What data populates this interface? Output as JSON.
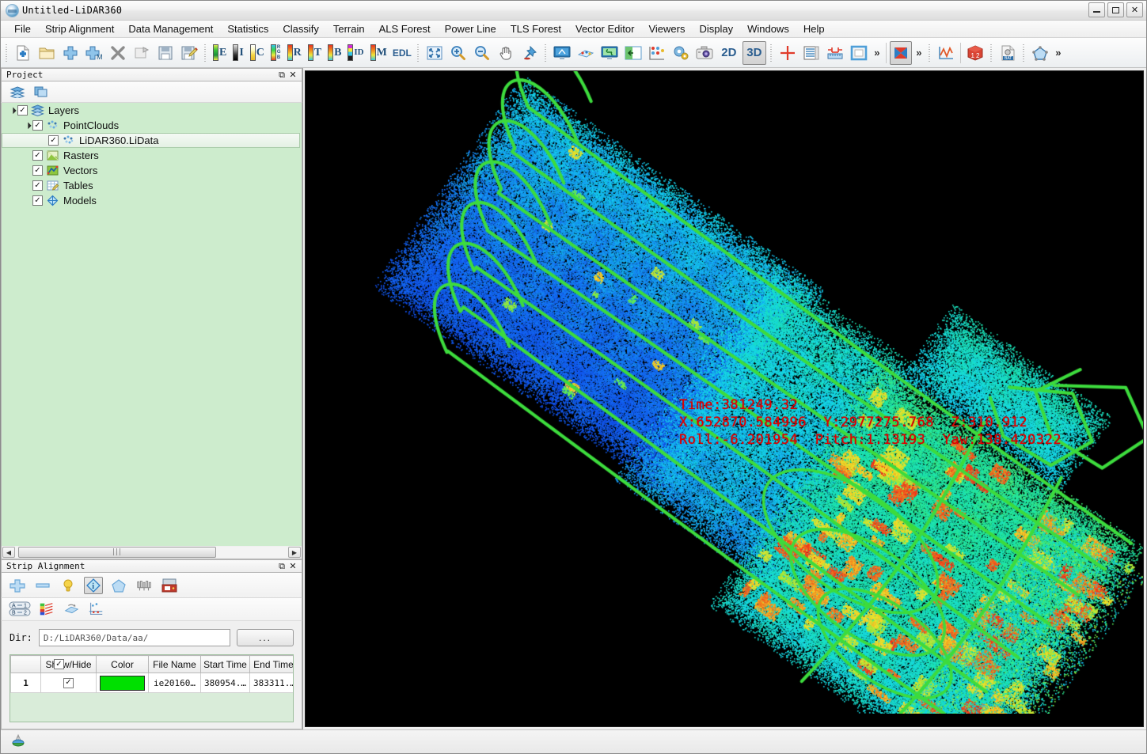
{
  "window": {
    "title": "Untitled-LiDAR360",
    "app_icon": "lidar360-logo-icon",
    "minimize": "minimize-icon",
    "maximize": "maximize-icon",
    "close": "close-icon"
  },
  "menubar": {
    "items": [
      {
        "label": "File"
      },
      {
        "label": "Strip Alignment"
      },
      {
        "label": "Data Management"
      },
      {
        "label": "Statistics"
      },
      {
        "label": "Classify"
      },
      {
        "label": "Terrain"
      },
      {
        "label": "ALS Forest"
      },
      {
        "label": "Power Line"
      },
      {
        "label": "TLS Forest"
      },
      {
        "label": "Vector Editor"
      },
      {
        "label": "Viewers"
      },
      {
        "label": "Display"
      },
      {
        "label": "Windows"
      },
      {
        "label": "Help"
      }
    ]
  },
  "toolbar": {
    "file_group": [
      {
        "name": "new-project-icon"
      },
      {
        "name": "open-folder-icon"
      },
      {
        "name": "add-data-icon"
      },
      {
        "name": "add-multiple-data-icon"
      },
      {
        "name": "remove-data-icon"
      },
      {
        "name": "export-data-icon"
      },
      {
        "name": "save-icon"
      },
      {
        "name": "save-as-icon"
      }
    ],
    "display_modes": [
      {
        "label": "E",
        "ramp": "e",
        "name": "color-by-elevation-button"
      },
      {
        "label": "I",
        "ramp": "i",
        "name": "color-by-intensity-button"
      },
      {
        "label": "C",
        "ramp": "c",
        "name": "color-by-class-button"
      },
      {
        "label": "RGB",
        "ramp": "rgb",
        "name": "color-by-rgb-button"
      },
      {
        "label": "R",
        "ramp": "r",
        "name": "color-by-return-button"
      },
      {
        "label": "T",
        "ramp": "t",
        "name": "color-by-time-button"
      },
      {
        "label": "B",
        "ramp": "b",
        "name": "color-by-blend-button"
      },
      {
        "label": "ID",
        "ramp": "id",
        "name": "color-by-id-button"
      },
      {
        "label": "M",
        "ramp": "m",
        "name": "color-by-model-button"
      }
    ],
    "edl_label": "EDL",
    "nav_group": [
      {
        "name": "zoom-extent-icon"
      },
      {
        "name": "zoom-in-icon"
      },
      {
        "name": "zoom-out-icon"
      },
      {
        "name": "pan-icon"
      },
      {
        "name": "pin-icon"
      }
    ],
    "view_group": [
      {
        "name": "profile-view-icon"
      },
      {
        "name": "point-cloud-view-icon"
      },
      {
        "name": "link-view-icon"
      },
      {
        "name": "split-view-icon"
      },
      {
        "name": "settings-points-icon"
      },
      {
        "name": "preferences-gear-icon"
      },
      {
        "name": "snapshot-camera-icon"
      }
    ],
    "dim_2d": "2D",
    "dim_3d": "3D",
    "dim_active": "3D",
    "measure_group": [
      {
        "name": "crosshair-icon"
      },
      {
        "name": "table-list-icon"
      },
      {
        "name": "measure-length-icon"
      },
      {
        "name": "measure-area-icon"
      }
    ],
    "overflow_chevron": "»",
    "extra_group": [
      {
        "name": "tri-color-fan-icon"
      },
      {
        "name": "line-chart-icon"
      },
      {
        "name": "cube-12-icon"
      },
      {
        "name": "bat-file-icon"
      },
      {
        "name": "polygon-edit-icon"
      }
    ]
  },
  "project_panel": {
    "title": "Project",
    "float_button": "restore-panel-icon",
    "close_button": "close-panel-icon",
    "toolbar": [
      {
        "name": "layers-stack-icon"
      },
      {
        "name": "copy-layers-icon"
      }
    ],
    "tree": [
      {
        "label": "Layers",
        "icon": "layers-stack-icon",
        "depth": 0,
        "checked": true,
        "expandable": true,
        "selected": false
      },
      {
        "label": "PointClouds",
        "icon": "point-cloud-icon",
        "depth": 1,
        "checked": true,
        "expandable": true,
        "selected": false
      },
      {
        "label": "LiDAR360.LiData",
        "icon": "point-cloud-icon",
        "depth": 2,
        "checked": true,
        "expandable": false,
        "selected": true
      },
      {
        "label": "Rasters",
        "icon": "raster-icon",
        "depth": 1,
        "checked": true,
        "expandable": false,
        "selected": false
      },
      {
        "label": "Vectors",
        "icon": "vector-icon",
        "depth": 1,
        "checked": true,
        "expandable": false,
        "selected": false
      },
      {
        "label": "Tables",
        "icon": "table-icon",
        "depth": 1,
        "checked": true,
        "expandable": false,
        "selected": false
      },
      {
        "label": "Models",
        "icon": "model-icon",
        "depth": 1,
        "checked": true,
        "expandable": false,
        "selected": false
      }
    ],
    "checkmark": "✓",
    "scroll_left": "◀",
    "scroll_right": "▶",
    "scroll_grip": "|||"
  },
  "strip_panel": {
    "title": "Strip Alignment",
    "float_button": "restore-panel-icon",
    "close_button": "close-panel-icon",
    "toolbar_row1": [
      {
        "name": "add-strip-icon"
      },
      {
        "name": "remove-strip-icon"
      },
      {
        "name": "bulb-hint-icon"
      },
      {
        "name": "strip-info-icon",
        "active": true
      },
      {
        "name": "pentagon-boundary-icon"
      },
      {
        "name": "waveform-icon"
      },
      {
        "name": "save-strip-icon"
      }
    ],
    "toolbar_row2": [
      {
        "name": "sort-ab-12-icon"
      },
      {
        "name": "color-legend-icon"
      },
      {
        "name": "rotate-plane-icon"
      },
      {
        "name": "scatter-axes-icon"
      }
    ],
    "dir_label": "Dir:",
    "dir_value": "D:/LiDAR360/Data/aa/",
    "dir_placeholder": "D:/LiDAR360/Data/aa/",
    "browse_label": "...",
    "table": {
      "columns": [
        "",
        "Show/Hide",
        "Color",
        "File Name",
        "Start Time",
        "End Time"
      ],
      "header_checkbox": true,
      "rows": [
        {
          "index": "1",
          "show_hide": true,
          "color": "#00E000",
          "file_name": "ie20160…",
          "start_time": "380954.…",
          "end_time": "383311.…"
        }
      ]
    },
    "checkmark": "✓"
  },
  "viewport": {
    "name": "point-cloud-3d-viewport",
    "background": "#000000",
    "trajectory_color": "#3ddb3d",
    "overlay_color": "#e00000",
    "overlay": {
      "line1": "Time:381249.32",
      "line2": "X:652870.584996  Y:2977275.768  Z:310.912",
      "line3": "Roll:-6.201954  Pitch:1.13193  Yaw:138.420322"
    }
  },
  "statusbar": {
    "icon": "globe-status-icon",
    "text": ""
  }
}
